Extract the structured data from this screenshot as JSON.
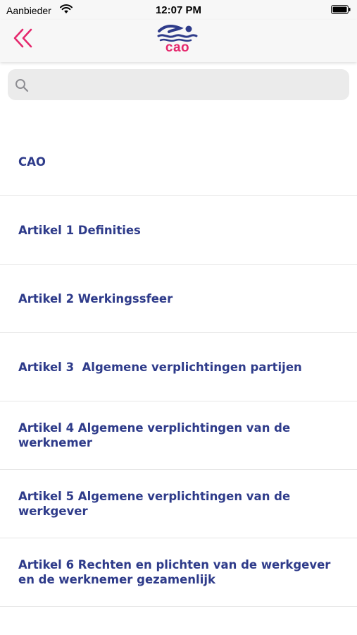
{
  "status_bar": {
    "carrier": "Aanbieder",
    "time": "12:07 PM"
  },
  "nav": {
    "logo_text": "cao",
    "back_icon": "double-chevron-left-icon",
    "accent_color": "#e5286d",
    "brand_blue": "#2e3b8a"
  },
  "search": {
    "placeholder": "",
    "value": ""
  },
  "items": [
    {
      "label": "CAO"
    },
    {
      "label": "Artikel 1 Definities"
    },
    {
      "label": "Artikel 2 Werkingssfeer"
    },
    {
      "label": "Artikel 3  Algemene verplichtingen partijen"
    },
    {
      "label": "Artikel 4 Algemene verplichtingen van de werknemer"
    },
    {
      "label": "Artikel 5 Algemene verplichtingen van de werkgever"
    },
    {
      "label": "Artikel 6 Rechten en plichten van de werkgever en de werknemer gezamenlijk"
    }
  ]
}
